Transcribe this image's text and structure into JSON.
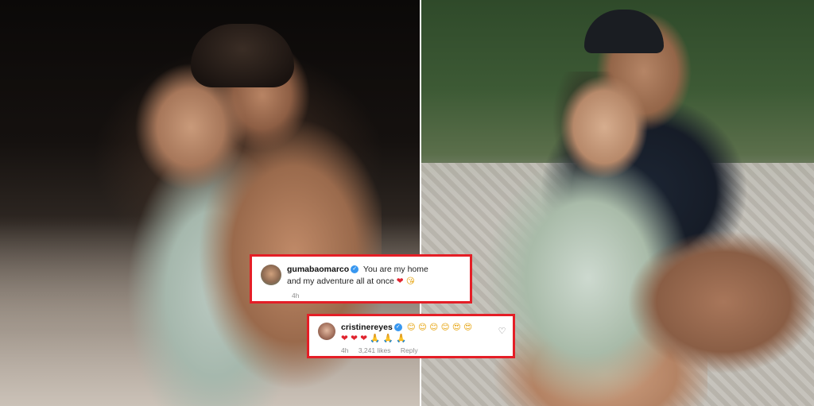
{
  "comments": [
    {
      "username": "gumabaomarco",
      "text_line1": "You are my home",
      "text_line2": "and my adventure all at once",
      "emoji_line2": "❤️ 😘",
      "time": "4h"
    },
    {
      "username": "cristinereyes",
      "emoji_line1": "😊 😊 😊 😊 😍 😍",
      "emoji_line2": "❤️ ❤️ ❤️ 🙏 🙏 🙏",
      "time": "4h",
      "likes": "3,241 likes",
      "reply_label": "Reply"
    }
  ],
  "icons": {
    "verified": "verified-badge-icon",
    "like": "heart-outline-icon"
  },
  "colors": {
    "highlight_border": "#e41e26",
    "verified_blue": "#3897f0"
  }
}
